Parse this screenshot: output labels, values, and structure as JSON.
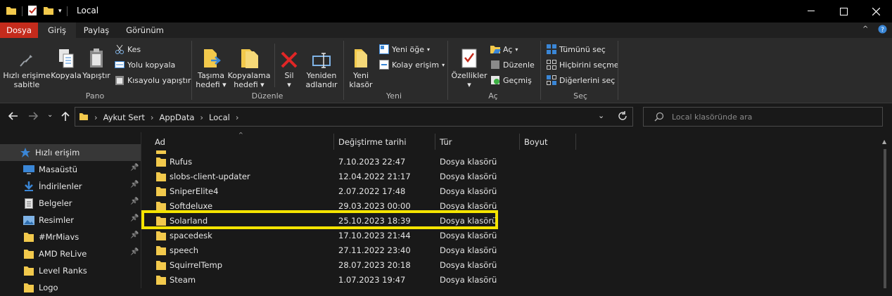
{
  "window": {
    "title": "Local",
    "minimize": "—",
    "maximize": "☐",
    "close": "✕"
  },
  "ribbon_tabs": [
    "Dosya",
    "Giriş",
    "Paylaş",
    "Görünüm"
  ],
  "ribbon": {
    "pano": {
      "group": "Pano",
      "pin_line1": "Hızlı erişime",
      "pin_line2": "sabitle",
      "copy": "Kopyala",
      "paste": "Yapıştır",
      "cut": "Kes",
      "copy_path": "Yolu kopyala",
      "paste_shortcut": "Kısayolu yapıştır"
    },
    "duzenle": {
      "group": "Düzenle",
      "move_line1": "Taşıma",
      "move_line2": "hedefi",
      "copyto_line1": "Kopyalama",
      "copyto_line2": "hedefi",
      "delete": "Sil",
      "rename_line1": "Yeniden",
      "rename_line2": "adlandır"
    },
    "yeni": {
      "group": "Yeni",
      "newfolder_line1": "Yeni",
      "newfolder_line2": "klasör",
      "new_item": "Yeni öğe",
      "easy_access": "Kolay erişim"
    },
    "ac": {
      "group": "Aç",
      "properties": "Özellikler",
      "open": "Aç",
      "edit": "Düzenle",
      "history": "Geçmiş"
    },
    "sec": {
      "group": "Seç",
      "select_all": "Tümünü seç",
      "select_none": "Hiçbirini seçme",
      "invert": "Diğerlerini seç"
    }
  },
  "address": {
    "crumbs": [
      "Aykut Sert",
      "AppData",
      "Local"
    ]
  },
  "search": {
    "placeholder": "Local klasöründe ara"
  },
  "nav": [
    {
      "label": "Hızlı erişim",
      "icon": "star-icon",
      "pinned": false
    },
    {
      "label": "Masaüstü",
      "icon": "desktop-icon",
      "pinned": true
    },
    {
      "label": "İndirilenler",
      "icon": "download-icon",
      "pinned": true
    },
    {
      "label": "Belgeler",
      "icon": "document-icon",
      "pinned": true
    },
    {
      "label": "Resimler",
      "icon": "pictures-icon",
      "pinned": true
    },
    {
      "label": "#MrMiavs",
      "icon": "folder-icon",
      "pinned": true
    },
    {
      "label": "AMD ReLive",
      "icon": "folder-icon",
      "pinned": true
    },
    {
      "label": "Level Ranks",
      "icon": "folder-icon",
      "pinned": false
    },
    {
      "label": "Logo",
      "icon": "folder-icon",
      "pinned": false
    }
  ],
  "columns": {
    "name": "Ad",
    "date": "Değiştirme tarihi",
    "type": "Tür",
    "size": "Boyut"
  },
  "files": [
    {
      "name": "Rufus",
      "date": "7.10.2023 22:47",
      "type": "Dosya klasörü"
    },
    {
      "name": "slobs-client-updater",
      "date": "12.04.2022 21:17",
      "type": "Dosya klasörü"
    },
    {
      "name": "SniperElite4",
      "date": "2.07.2022 17:48",
      "type": "Dosya klasörü"
    },
    {
      "name": "Softdeluxe",
      "date": "29.03.2023 00:00",
      "type": "Dosya klasörü"
    },
    {
      "name": "Solarland",
      "date": "25.10.2023 18:39",
      "type": "Dosya klasörü"
    },
    {
      "name": "spacedesk",
      "date": "17.10.2023 21:44",
      "type": "Dosya klasörü"
    },
    {
      "name": "speech",
      "date": "27.11.2022 23:40",
      "type": "Dosya klasörü"
    },
    {
      "name": "SquirrelTemp",
      "date": "28.07.2023 20:18",
      "type": "Dosya klasörü"
    },
    {
      "name": "Steam",
      "date": "1.07.2023 19:47",
      "type": "Dosya klasörü"
    }
  ],
  "highlighted_file": "Solarland",
  "colors": {
    "highlight_box": "#f5e400",
    "file_tab": "#c42b1c",
    "folder": "#f2c94c"
  }
}
